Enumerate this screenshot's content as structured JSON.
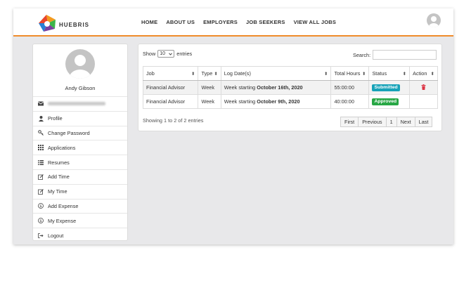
{
  "header": {
    "brand": "HUEBRIS",
    "nav": [
      "HOME",
      "ABOUT US",
      "EMPLOYERS",
      "JOB SEEKERS",
      "VIEW ALL JOBS"
    ]
  },
  "sidebar": {
    "name": "Andy Gibson",
    "items": [
      {
        "label": "",
        "icon": "envelope-icon"
      },
      {
        "label": "Profile",
        "icon": "user-icon"
      },
      {
        "label": "Change Password",
        "icon": "key-icon"
      },
      {
        "label": "Applications",
        "icon": "grid-icon"
      },
      {
        "label": "Resumes",
        "icon": "list-icon"
      },
      {
        "label": "Add Time",
        "icon": "edit-icon"
      },
      {
        "label": "My Time",
        "icon": "edit-icon"
      },
      {
        "label": "Add Expense",
        "icon": "dollar-icon"
      },
      {
        "label": "My Expense",
        "icon": "dollar-icon"
      },
      {
        "label": "Logout",
        "icon": "logout-icon"
      }
    ]
  },
  "table": {
    "show_label": "Show",
    "entries_label": "entries",
    "length_value": "10",
    "search_label": "Search:",
    "search_value": "",
    "columns": [
      "Job",
      "Type",
      "Log Date(s)",
      "Total Hours",
      "Status",
      "Action"
    ],
    "rows": [
      {
        "job": "Financial Advisor",
        "type": "Week",
        "date_prefix": "Week starting ",
        "date_bold": "October 16th, 2020",
        "hours": "55:00:00",
        "status": "Submitted",
        "has_delete": true
      },
      {
        "job": "Financial Advisor",
        "type": "Week",
        "date_prefix": "Week starting ",
        "date_bold": "October 9th, 2020",
        "hours": "40:00:00",
        "status": "Approved",
        "has_delete": false
      }
    ],
    "info": "Showing 1 to 2 of 2 entries",
    "pagination": [
      "First",
      "Previous",
      "1",
      "Next",
      "Last"
    ]
  },
  "colors": {
    "accent": "#f08c2b",
    "submitted": "#17a2b8",
    "approved": "#28a745",
    "delete": "#dc3545"
  }
}
